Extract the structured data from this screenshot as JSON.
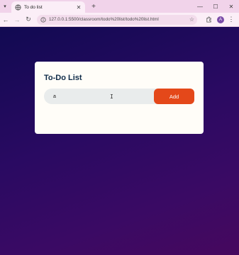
{
  "browser": {
    "tab": {
      "title": "To do list"
    },
    "address": {
      "url": "127.0.0.1:5500/classroom/todo%20list/todo%20list.html"
    },
    "profile_initial": "A",
    "icons": {
      "tab_menu": "chevron-down-icon",
      "tab_close": "close-icon",
      "new_tab": "plus-icon",
      "back": "arrow-left-icon",
      "forward": "arrow-right-icon",
      "reload": "reload-icon",
      "info": "site-info-icon",
      "bookmark": "star-icon",
      "extensions": "puzzle-icon",
      "menu": "kebab-menu-icon"
    }
  },
  "app": {
    "title": "To-Do List",
    "input": {
      "value": "a",
      "placeholder": ""
    },
    "add_label": "Add"
  },
  "colors": {
    "accent": "#e4481a",
    "title": "#0e2a47",
    "card": "#fffdf8",
    "input_bg": "#e9ecec"
  }
}
